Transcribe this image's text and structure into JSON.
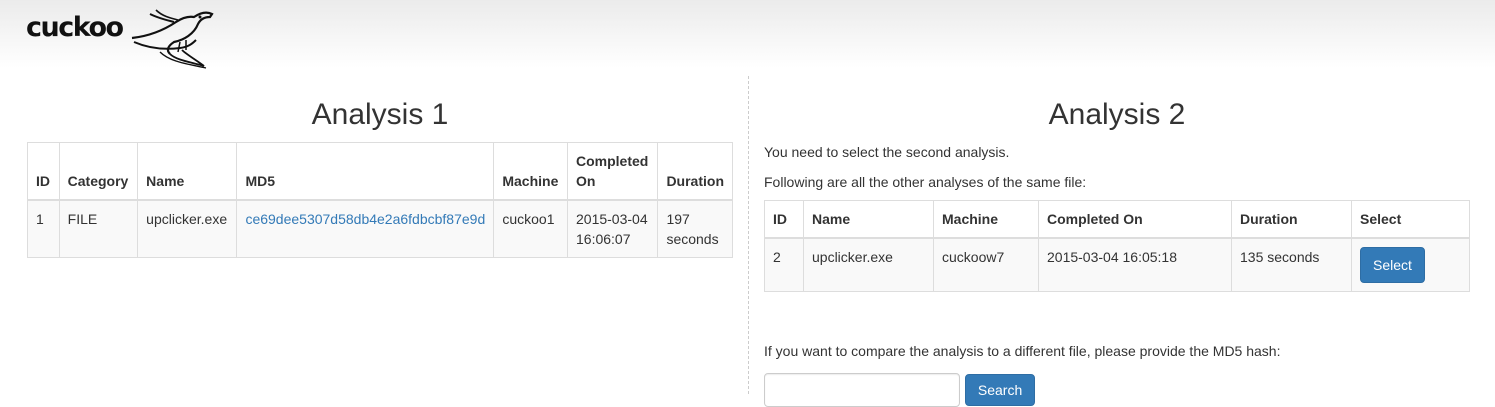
{
  "brand": {
    "logo_text": "cuckoo"
  },
  "analysis1": {
    "title": "Analysis 1",
    "columns": [
      "ID",
      "Category",
      "Name",
      "MD5",
      "Machine",
      "Completed On",
      "Duration"
    ],
    "row": {
      "id": "1",
      "category": "FILE",
      "name": "upclicker.exe",
      "md5": "ce69dee5307d58db4e2a6fdbcbf87e9d",
      "machine": "cuckoo1",
      "completed_on": "2015-03-04 16:06:07",
      "duration": "197 seconds"
    }
  },
  "analysis2": {
    "title": "Analysis 2",
    "note1": "You need to select the second analysis.",
    "note2": "Following are all the other analyses of the same file:",
    "columns": [
      "ID",
      "Name",
      "Machine",
      "Completed On",
      "Duration",
      "Select"
    ],
    "row": {
      "id": "2",
      "name": "upclicker.exe",
      "machine": "cuckoow7",
      "completed_on": "2015-03-04 16:05:18",
      "duration": "135 seconds",
      "select_label": "Select"
    },
    "compare_text": "If you want to compare the analysis to a different file, please provide the MD5 hash:",
    "search": {
      "value": "",
      "button_label": "Search"
    }
  },
  "colors": {
    "link": "#337ab7",
    "button": "#337ab7"
  }
}
